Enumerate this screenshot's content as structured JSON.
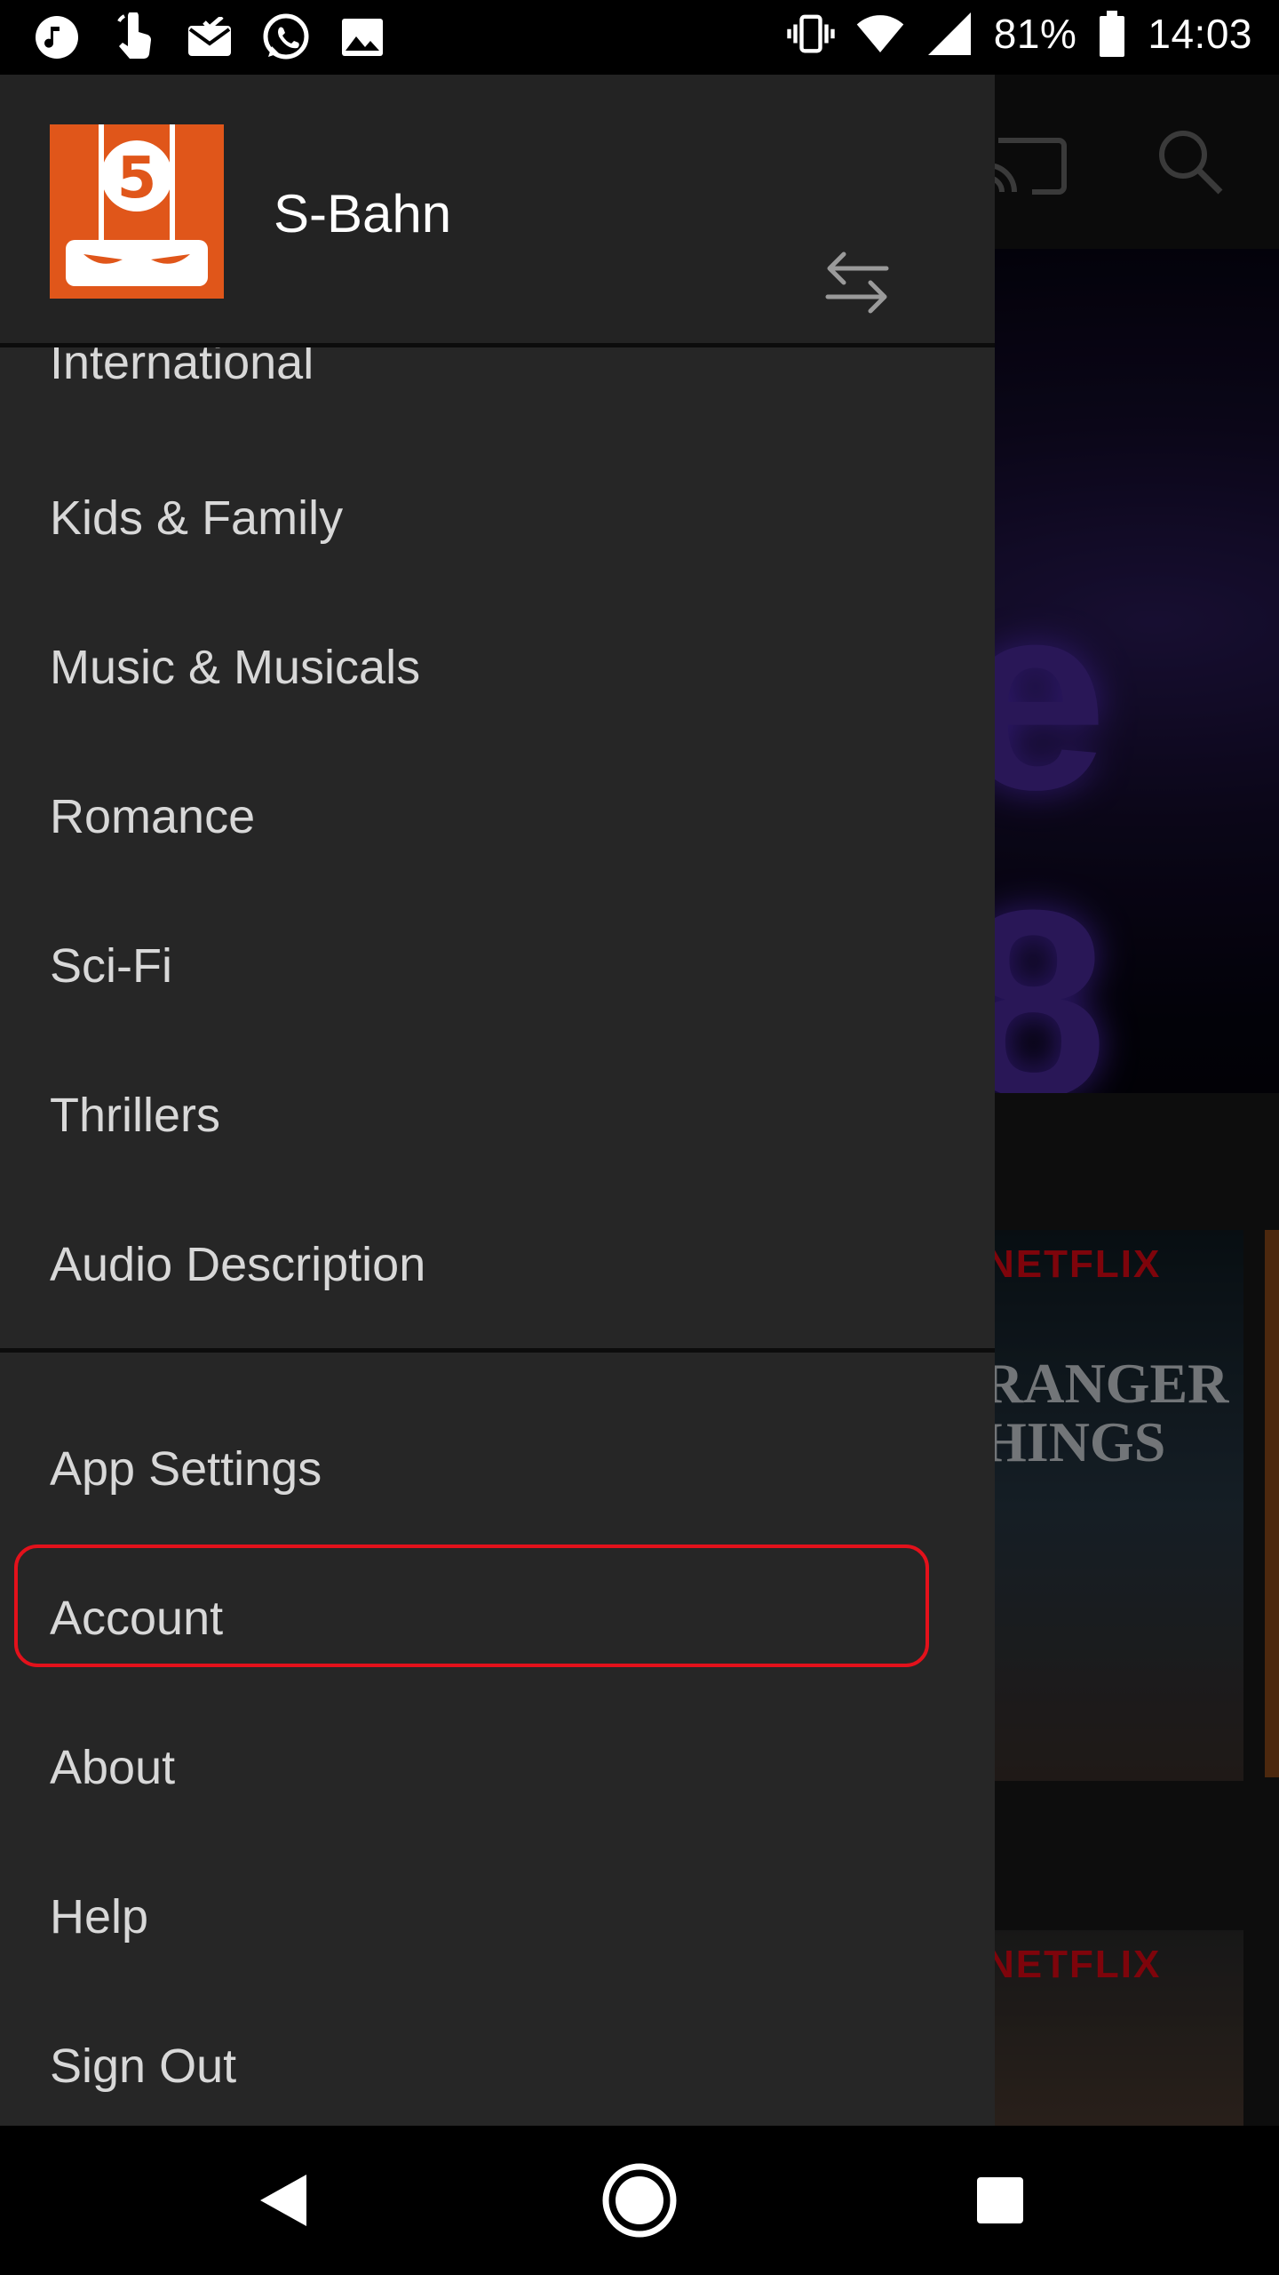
{
  "status_bar": {
    "battery_percent": "81%",
    "time": "14:03",
    "left_icons": [
      "music-icon",
      "touch-icon",
      "mail-check-icon",
      "whatsapp-icon",
      "image-icon"
    ],
    "right_icons": [
      "vibrate-icon",
      "wifi-icon",
      "signal-icon",
      "battery-icon"
    ]
  },
  "drawer": {
    "profile": {
      "name": "S-Bahn",
      "avatar_color": "#e0561a"
    },
    "genres": [
      {
        "label": "International"
      },
      {
        "label": "Kids & Family"
      },
      {
        "label": "Music & Musicals"
      },
      {
        "label": "Romance"
      },
      {
        "label": "Sci-Fi"
      },
      {
        "label": "Thrillers"
      },
      {
        "label": "Audio Description"
      }
    ],
    "settings": [
      {
        "label": "App Settings"
      },
      {
        "label": "Account"
      },
      {
        "label": "About"
      },
      {
        "label": "Help"
      },
      {
        "label": "Sign Out"
      }
    ],
    "highlight_color": "#e3111b"
  },
  "background": {
    "hero_text": "e 8",
    "posters": [
      {
        "brand": "NETFLIX",
        "title": "RANGER\nHINGS"
      },
      {
        "brand": "NETFLIX",
        "title": ""
      }
    ]
  },
  "colors": {
    "drawer_bg": "#262626",
    "text": "#d8d8d8",
    "netflix_red": "#e50914"
  }
}
